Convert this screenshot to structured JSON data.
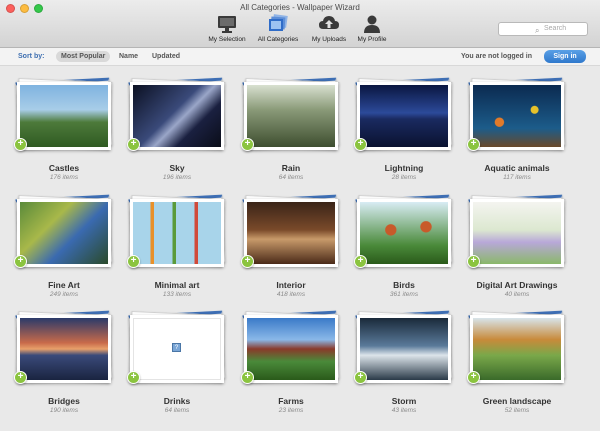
{
  "window": {
    "title": "All Categories - Wallpaper Wizard"
  },
  "toolbar": {
    "buttons": [
      {
        "label": "My Selection",
        "icon": "monitor-icon"
      },
      {
        "label": "All Categories",
        "icon": "folders-icon"
      },
      {
        "label": "My Uploads",
        "icon": "cloud-upload-icon"
      },
      {
        "label": "My Profile",
        "icon": "person-icon"
      }
    ],
    "active": "All Categories"
  },
  "search": {
    "placeholder": "Search"
  },
  "sortbar": {
    "label": "Sort by:",
    "options": [
      "Most Popular",
      "Name",
      "Updated"
    ],
    "active": "Most Popular",
    "status": "You are not logged in",
    "signin_label": "Sign in"
  },
  "categories": [
    {
      "name": "Castles",
      "count": "176 items"
    },
    {
      "name": "Sky",
      "count": "196 items"
    },
    {
      "name": "Rain",
      "count": "64 items"
    },
    {
      "name": "Lightning",
      "count": "28 items"
    },
    {
      "name": "Aquatic animals",
      "count": "117 items"
    },
    {
      "name": "Fine Art",
      "count": "249 items"
    },
    {
      "name": "Minimal art",
      "count": "133 items"
    },
    {
      "name": "Interior",
      "count": "418 items"
    },
    {
      "name": "Birds",
      "count": "361 items"
    },
    {
      "name": "Digital Art Drawings",
      "count": "40 items"
    },
    {
      "name": "Bridges",
      "count": "190 items"
    },
    {
      "name": "Drinks",
      "count": "64 items"
    },
    {
      "name": "Farms",
      "count": "23 items"
    },
    {
      "name": "Storm",
      "count": "43 items"
    },
    {
      "name": "Green landscape",
      "count": "52 items"
    }
  ],
  "add_label": "+",
  "colors": {
    "accent": "#3d6eb0",
    "add_button": "#8bc43f",
    "signin": "#2f78cc"
  }
}
